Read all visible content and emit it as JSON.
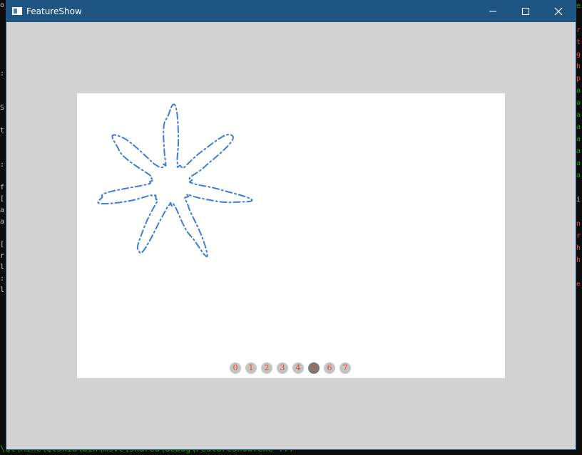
{
  "window": {
    "title": "FeatureShow",
    "icon": "app-window-icon",
    "controls": [
      "minimize-icon",
      "maximize-icon",
      "close-icon"
    ]
  },
  "colors": {
    "titlebar": "#1f5582",
    "client_background": "#d3d3d3",
    "canvas_background": "#ffffff",
    "curve": "#3b7ddd",
    "page_dot": "#c4c4c4",
    "page_dot_active": "#7b7b7b",
    "page_dot_text": "#e8402a"
  },
  "canvas": {
    "shape": "seven-petal star curve",
    "stroke_style": "dash-dot",
    "petals": 7
  },
  "pager": {
    "pages": [
      "0",
      "1",
      "2",
      "3",
      "4",
      "5",
      "6",
      "7"
    ],
    "active_index": 5
  },
  "console": {
    "bottom_line": "\\Qt\\Mine\\QtSkia\\bin\\msvc\\shared\\debug\\FeatureShow.exe ..."
  }
}
